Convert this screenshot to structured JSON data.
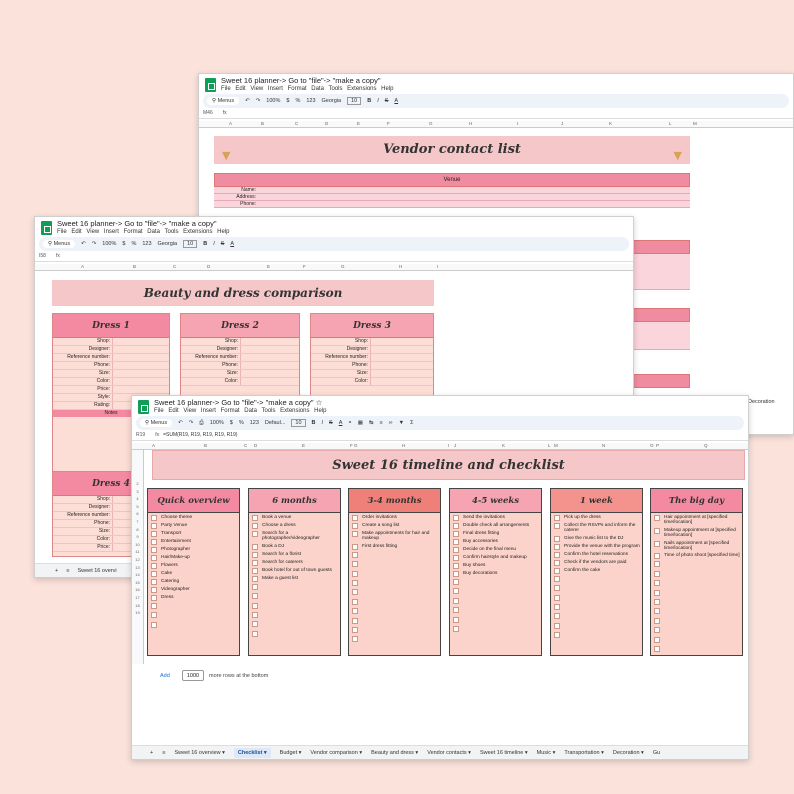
{
  "colors": {
    "bg": "#fbe3dc",
    "pink": "#f48aa2",
    "light": "#fcd3ca",
    "title": "#f5c7c9",
    "sheets": "#0f9d58"
  },
  "back": {
    "title": "Sweet 16 planner-> Go to \"file\"-> \"make a copy\"",
    "menus": "File Edit View Insert Format Data Tools Extensions Help",
    "toolbar": {
      "search": "Menus",
      "zoom": "100%",
      "font": "Georgia",
      "size": "10",
      "currency": "$",
      "pct": "%",
      "num": "123"
    },
    "cell": "M46",
    "fx": "fx",
    "cols": [
      "A",
      "B",
      "C",
      "D",
      "E",
      "F",
      "G",
      "H",
      "I",
      "J",
      "K",
      "L",
      "M"
    ],
    "heading": "Vendor contact list",
    "venue": "Venue",
    "labels": [
      "Name:",
      "Address:",
      "Phone:"
    ],
    "tab": "Decoration"
  },
  "middle": {
    "title": "Sweet 16 planner-> Go to \"file\"-> \"make a copy\"",
    "menus": "File Edit View Insert Format Data Tools Extensions Help",
    "toolbar": {
      "search": "Menus",
      "zoom": "100%",
      "font": "Georgia",
      "size": "10",
      "currency": "$",
      "pct": "%",
      "num": "123"
    },
    "cell": "I58",
    "fx": "fx",
    "cols": [
      "A",
      "B",
      "C",
      "D",
      "E",
      "F",
      "G",
      "H",
      "I"
    ],
    "heading": "Beauty and dress comparison",
    "dresses": [
      "Dress 1",
      "Dress 2",
      "Dress 3",
      "Dress 4"
    ],
    "fields": [
      "Shop:",
      "Designer:",
      "Reference number:",
      "Phone:",
      "Size:",
      "Color:",
      "Price:",
      "Style:",
      "Rating:"
    ],
    "fields4": [
      "Shop:",
      "Designer:",
      "Reference number:",
      "Phone:",
      "Size:",
      "Color:",
      "Price:"
    ],
    "notes": "Notes",
    "tab": "Sweet 16 overvi"
  },
  "front": {
    "title": "Sweet 16 planner-> Go to \"file\"-> \"make a copy\"",
    "menus": "File Edit View Insert Format Data Tools Extensions Help",
    "toolbar": {
      "search": "Menus",
      "zoom": "100%",
      "font": "Defaul...",
      "size": "10",
      "currency": "$",
      "pct": "%",
      "num": "123"
    },
    "cell": "R19",
    "fx": "fx",
    "formula": "=SUM(R19, R19, R19, R19, R19)",
    "cols": [
      "A",
      "B",
      "C",
      "D",
      "E",
      "F",
      "G",
      "H",
      "I",
      "J",
      "K",
      "L",
      "M",
      "N",
      "O",
      "P",
      "Q"
    ],
    "heading": "Sweet 16 timeline and checklist",
    "columns": [
      {
        "title": "Quick overview",
        "color": "#f48aa2",
        "items": [
          "Choose theme",
          "Party Venue",
          "Transport",
          "Entertainment",
          "Photographer",
          "Hair/Make-up",
          "Flowers",
          "Cake",
          "Catering",
          "Videographer",
          "Dress"
        ]
      },
      {
        "title": "6 months",
        "color": "#f6a3b2",
        "items": [
          "Book a venue",
          "Choose a dress",
          "Search for a photographer/videographer",
          "Book a DJ",
          "Search for a florist",
          "Search for caterers",
          "Book hotel for out of town guests",
          "Make a guest list"
        ]
      },
      {
        "title": "3-4 months",
        "color": "#ef8079",
        "items": [
          "Order invitations",
          "Create a song list",
          "Make appointments for hair and makeup",
          "First dress fitting"
        ]
      },
      {
        "title": "4-5 weeks",
        "color": "#f6a3b2",
        "items": [
          "Send the invitations",
          "Double check all arrangements",
          "Final dress fitting",
          "Buy accessories",
          "Decide on the final menu",
          "Confirm hairstyle and makeup",
          "Buy shoes",
          "Buy decorations"
        ]
      },
      {
        "title": "1 week",
        "color": "#f4938d",
        "items": [
          "Pick up the dress",
          "Collect the RSVPs and inform the caterer",
          "Give the music list to the DJ",
          "Provide the venue with the program",
          "Confirm the hotel reservations",
          "Check if the vendors are paid",
          "Confirm the cake"
        ]
      },
      {
        "title": "The big day",
        "color": "#f48aa2",
        "items": [
          "Hair appointment at [specified time/location]",
          "Makeup appointment at [specified time/location]",
          "Nails appointment at [specified time/location]",
          "Time of photo shoot [specified time]"
        ]
      }
    ],
    "add": "Add",
    "rows_count": "1000",
    "more_rows": "more rows at the bottom",
    "tabs": [
      "Sweet 16 overview",
      "Checklist",
      "Budget",
      "Vendor comparison",
      "Beauty and dress",
      "Vendor contacts",
      "Sweet 16 timeline",
      "Music",
      "Transportation",
      "Decoration",
      "Gu"
    ]
  }
}
